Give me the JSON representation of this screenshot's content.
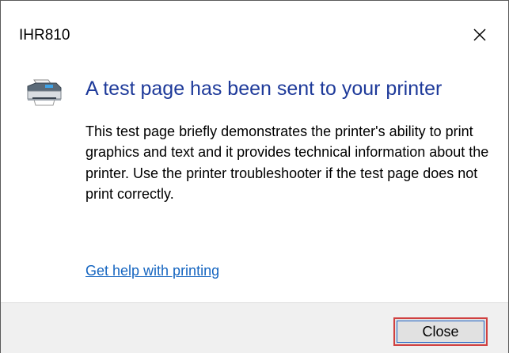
{
  "window": {
    "title": "IHR810",
    "close_icon": "close-x-icon"
  },
  "message": {
    "icon": "printer-icon",
    "heading": "A test page has been sent to your printer",
    "body": "This test page briefly demonstrates the printer's ability to print graphics and text and it provides technical information about the printer. Use the printer troubleshooter if the test page does not print correctly.",
    "link": "Get help with printing"
  },
  "footer": {
    "close_label": "Close"
  },
  "colors": {
    "heading": "#1e3a9a",
    "link": "#1565c0",
    "focus_outline": "#d04040",
    "footer_bg": "#f0f0f0"
  }
}
